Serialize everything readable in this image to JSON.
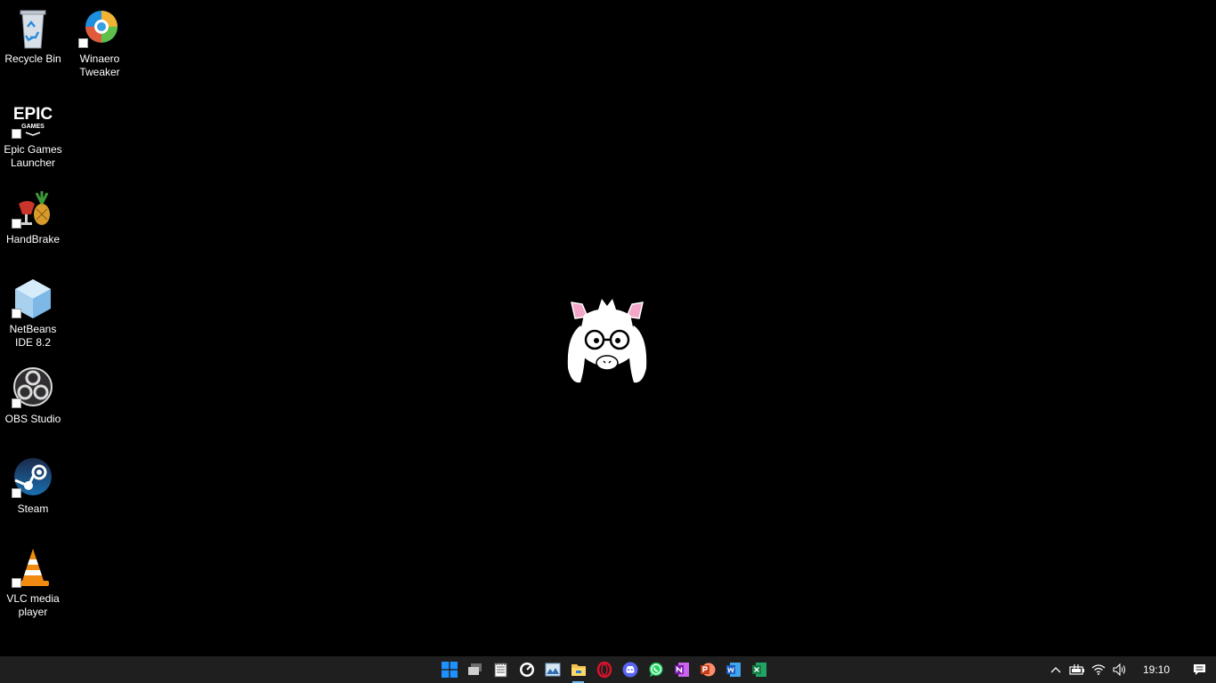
{
  "desktop": {
    "background_color": "#000000",
    "icons": [
      {
        "name": "recycle-bin",
        "label": "Recycle Bin",
        "shortcut": false
      },
      {
        "name": "winaero-tweaker",
        "label": "Winaero Tweaker",
        "shortcut": true
      },
      {
        "name": "epic-games-launcher",
        "label": "Epic Games Launcher",
        "shortcut": true,
        "logo_text": "EPIC",
        "logo_subtext": "GAMES"
      },
      {
        "name": "handbrake",
        "label": "HandBrake",
        "shortcut": true
      },
      {
        "name": "netbeans-ide",
        "label": "NetBeans IDE 8.2",
        "shortcut": true
      },
      {
        "name": "obs-studio",
        "label": "OBS Studio",
        "shortcut": true
      },
      {
        "name": "steam",
        "label": "Steam",
        "shortcut": true
      },
      {
        "name": "vlc-media-player",
        "label": "VLC media player",
        "shortcut": true
      }
    ],
    "wallpaper_art": "goat-character-with-glasses-pixel-art"
  },
  "taskbar": {
    "background": "#1f1f1f",
    "apps": [
      {
        "name": "start-button",
        "icon": "windows-logo-icon"
      },
      {
        "name": "task-view-button",
        "icon": "task-view-icon"
      },
      {
        "name": "notepad-button",
        "icon": "notepad-icon"
      },
      {
        "name": "speedometer-app-button",
        "icon": "speedometer-icon"
      },
      {
        "name": "photos-button",
        "icon": "photos-icon"
      },
      {
        "name": "file-explorer-button",
        "icon": "folder-icon",
        "running": true
      },
      {
        "name": "opera-button",
        "icon": "opera-icon"
      },
      {
        "name": "discord-button",
        "icon": "discord-icon"
      },
      {
        "name": "whatsapp-button",
        "icon": "whatsapp-icon"
      },
      {
        "name": "onenote-button",
        "icon": "onenote-icon"
      },
      {
        "name": "powerpoint-button",
        "icon": "powerpoint-icon"
      },
      {
        "name": "word-button",
        "icon": "word-icon"
      },
      {
        "name": "excel-button",
        "icon": "excel-icon"
      }
    ],
    "tray": {
      "icons": [
        "chevron-up-icon",
        "battery-icon",
        "wifi-icon",
        "speaker-icon"
      ],
      "clock": "19:10",
      "notification_icon": "action-center-icon"
    },
    "accent": "#76b9ed"
  }
}
